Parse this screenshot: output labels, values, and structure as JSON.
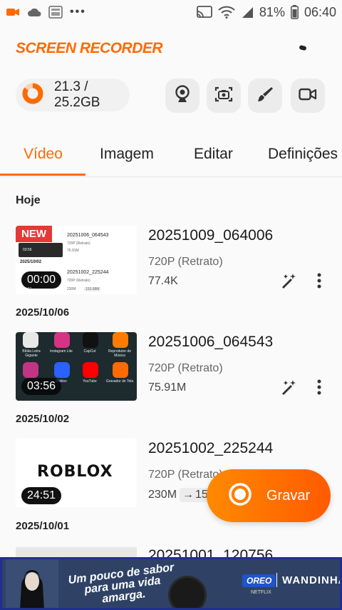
{
  "status_bar": {
    "battery": "81%",
    "time": "06:40"
  },
  "header": {
    "app_title": "SCREEN RECORDER"
  },
  "storage": {
    "text": "21.3 / 25.2GB",
    "used_fraction": 0.845
  },
  "toolbar": {
    "icons": [
      "webcam-icon",
      "screenshot-icon",
      "brush-icon",
      "video-camera-icon"
    ]
  },
  "tabs": [
    {
      "label": "Vídeo",
      "active": true
    },
    {
      "label": "Imagem",
      "active": false
    },
    {
      "label": "Editar",
      "active": false
    },
    {
      "label": "Definições",
      "active": false
    }
  ],
  "section": {
    "today_label": "Hoje"
  },
  "videos": [
    {
      "badge": "NEW",
      "title": "20251009_064006",
      "resolution": "720P (Retrato)",
      "size": "77.4K",
      "duration": "00:00",
      "date_after": "2025/10/06",
      "thumb": {
        "item1_title": "20251006_064543",
        "item1_sub": "720P (Retrato)",
        "item1_size": "75.91M",
        "item1_dur": "03:56",
        "date": "2025/10/02",
        "item2_title": "20251002_225244",
        "item2_sub": "720P (Retrato)",
        "item2_size": "230M",
        "item2_conv": "153.68M",
        "item2_dur": "24:51"
      }
    },
    {
      "title": "20251006_064543",
      "resolution": "720P (Retrato)",
      "size": "75.91M",
      "duration": "03:56",
      "date_after": "2025/10/02",
      "thumb": {
        "apps_row1": [
          "Bíblia Letra Gigante",
          "Instagram Lite",
          "CapCut",
          "Reprodutor de Música"
        ],
        "apps_row2": [
          "",
          "Roblox",
          "YouTube",
          "Gravador de Tela"
        ]
      }
    },
    {
      "title": "20251002_225244",
      "resolution": "720P (Retrato)",
      "size": "230M",
      "converted": "153.68M",
      "converted_visible": "15",
      "duration": "24:51",
      "date_after": "2025/10/01",
      "thumb": {
        "logo": "ROBLOX"
      }
    },
    {
      "title": "20251001_120756"
    }
  ],
  "fab": {
    "label": "Gravar"
  },
  "ad": {
    "headline": "Um pouco de sabor para uma vida amarga.",
    "oreo": "OREO",
    "brand": "WANDINHA",
    "small_text": "NETFLIX"
  },
  "colors": {
    "accent": "#ff6a00",
    "new_badge": "#e53935",
    "ad_background": "#2f4266"
  }
}
